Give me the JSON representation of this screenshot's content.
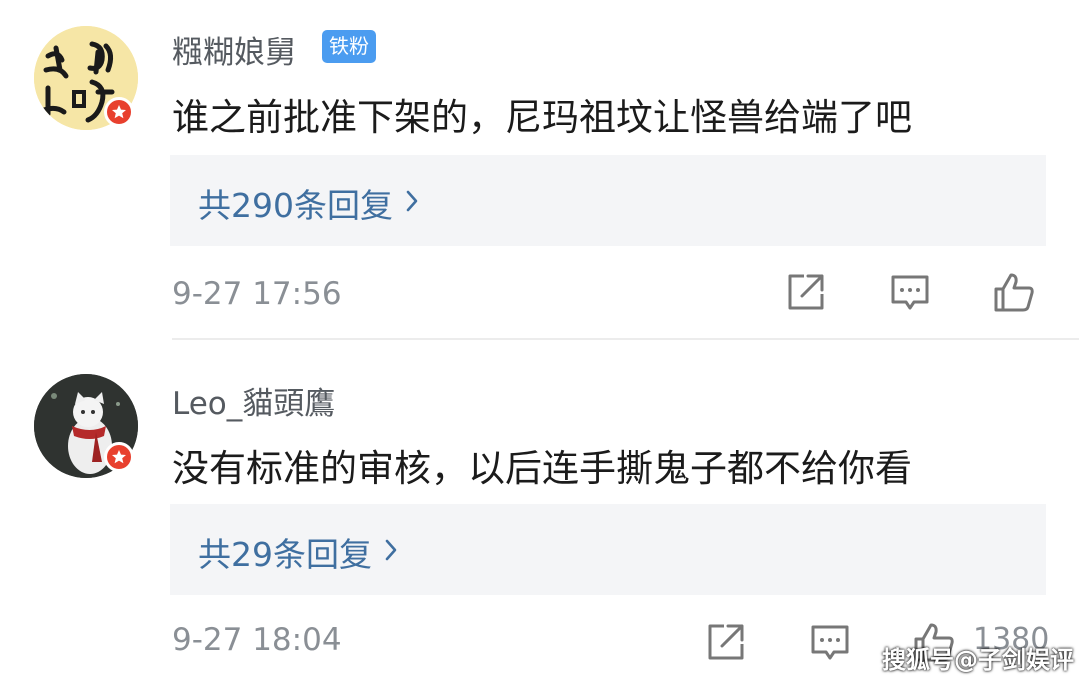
{
  "comments": [
    {
      "username": "糨糊娘舅",
      "fan_badge": "铁粉",
      "text": "谁之前批准下架的，尼玛祖坟让怪兽给端了吧",
      "replies_label": "共290条回复",
      "timestamp": "9-27 17:56"
    },
    {
      "username": "Leo_貓頭鷹",
      "text": "没有标准的审核，以后连手撕鬼子都不给你看",
      "replies_label": "共29条回复",
      "timestamp": "9-27 18:04",
      "like_count": "1380"
    }
  ],
  "icons": {
    "share": "share-icon",
    "comment": "comment-icon",
    "like": "thumbs-up-icon",
    "verified": "verified-star-icon"
  },
  "colors": {
    "link": "#3f6fa0",
    "fan_badge": "#4b9cf0",
    "verified": "#e8402e"
  },
  "watermark": "搜狐号@子剑娱评"
}
